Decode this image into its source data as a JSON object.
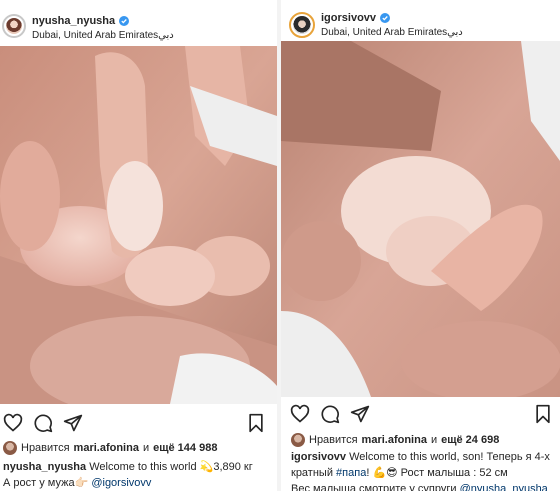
{
  "left_post": {
    "username": "nyusha_nyusha",
    "location": "Dubai, United Arab Emiratesدبي",
    "likes_prefix": "Нравится",
    "liked_by": "mari.afonina",
    "likes_mid": "и",
    "likes_count": "ещё 144 988",
    "caption_user": "nyusha_nyusha",
    "caption_line1": "Welcome to this world 💫3,890 кг",
    "caption_line2_text": "А рост у мужа👉🏻",
    "caption_line2_tag": "@igorsivovv"
  },
  "right_post": {
    "username": "igorsivovv",
    "location": "Dubai, United Arab Emiratesدبي",
    "likes_prefix": "Нравится",
    "liked_by": "mari.afonina",
    "likes_mid": "и",
    "likes_count": "ещё 24 698",
    "caption_user": "igorsivovv",
    "caption_line1": "Welcome to this world, son! Теперь я 4-х",
    "caption_line2_a": "кратный",
    "caption_line2_tag": "#папа",
    "caption_line2_b": "! 💪😎 Рост малыша : 52 см",
    "caption_line3_text": "Вес малыша смотрите у супруги",
    "caption_line3_tag": "@nyusha_nyusha"
  },
  "colors": {
    "verified": "#3897f0",
    "link": "#00376b",
    "text": "#262626"
  },
  "icons": [
    "heart-icon",
    "comment-icon",
    "share-icon",
    "bookmark-icon",
    "verified-icon",
    "more-icon"
  ]
}
